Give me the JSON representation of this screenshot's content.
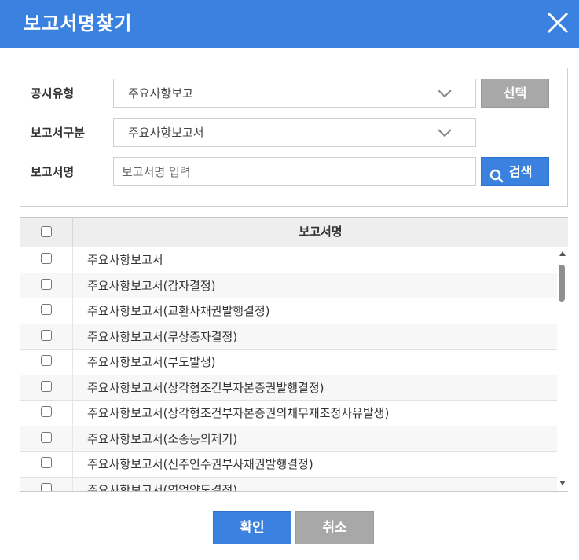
{
  "header": {
    "title": "보고서명찾기",
    "close_icon": "close-icon"
  },
  "filters": {
    "disclosure_type": {
      "label": "공시유형",
      "value": "주요사항보고"
    },
    "report_category": {
      "label": "보고서구분",
      "value": "주요사항보고서"
    },
    "report_name": {
      "label": "보고서명",
      "placeholder": "보고서명 입력",
      "value": ""
    },
    "select_button": "선택",
    "search_button": "검색",
    "search_icon": "search-icon"
  },
  "table": {
    "header": {
      "name_column": "보고서명"
    },
    "rows": [
      {
        "name": "주요사항보고서"
      },
      {
        "name": "주요사항보고서(감자결정)"
      },
      {
        "name": "주요사항보고서(교환사채권발행결정)"
      },
      {
        "name": "주요사항보고서(무상증자결정)"
      },
      {
        "name": "주요사항보고서(부도발생)"
      },
      {
        "name": "주요사항보고서(상각형조건부자본증권발행결정)"
      },
      {
        "name": "주요사항보고서(상각형조건부자본증권의채무재조정사유발생)"
      },
      {
        "name": "주요사항보고서(소송등의제기)"
      },
      {
        "name": "주요사항보고서(신주인수권부사채권발행결정)"
      },
      {
        "name": "주요사항보고서(영업양도결정)"
      }
    ]
  },
  "footer": {
    "confirm_button": "확인",
    "cancel_button": "취소"
  },
  "colors": {
    "primary": "#3b82e0",
    "secondary_button": "#a8a8a8",
    "header_row": "#eeeeee"
  }
}
